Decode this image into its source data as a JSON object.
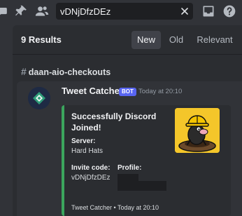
{
  "topbar": {
    "icons": [
      "pin-icon",
      "members-icon"
    ],
    "search": {
      "value": "vDNjDfzDEz"
    },
    "right_icons": [
      "inbox-icon",
      "help-icon"
    ]
  },
  "results": {
    "count_label": "9 Results",
    "tabs": [
      {
        "label": "New",
        "active": true
      },
      {
        "label": "Old",
        "active": false
      },
      {
        "label": "Relevant",
        "active": false
      }
    ]
  },
  "channel": {
    "name": "daan-aio-checkouts"
  },
  "message": {
    "author": "Tweet Catcher",
    "badge": "BOT",
    "timestamp": "Today at 20:10",
    "embed": {
      "accent_color": "#3ba55d",
      "title": "Successfully Discord Joined!",
      "server_label": "Server:",
      "server_value": "Hard Hats",
      "invite_label": "Invite code:",
      "invite_value": "vDNjDfzDEz",
      "profile_label": "Profile:",
      "footer": "Tweet Catcher • Today at 20:10"
    }
  }
}
